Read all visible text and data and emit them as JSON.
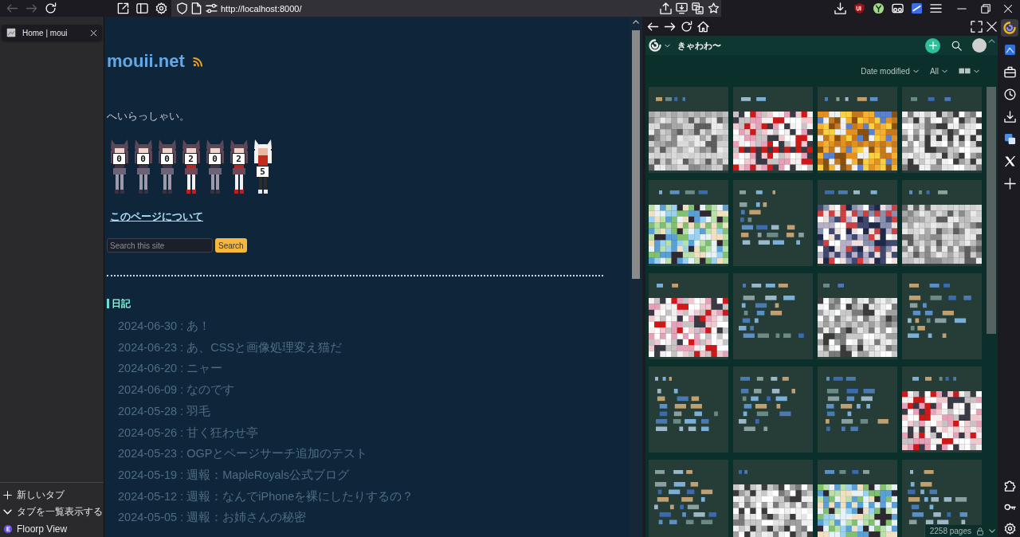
{
  "browser": {
    "back": {
      "disabled": true
    },
    "forward": {
      "disabled": true
    },
    "url": "http://localhost:8000/"
  },
  "tabs": [
    {
      "title": "Home | moui",
      "selected": true
    }
  ],
  "tab_sidebar_actions": [
    {
      "kind": "new",
      "label": "新しいタブ"
    },
    {
      "kind": "list",
      "label": "タブを一覧表示する"
    },
    {
      "kind": "view",
      "label": "Floorp View"
    }
  ],
  "page": {
    "site_title": "mouii.net",
    "greeting": "へいらっしゃい。",
    "counter": [
      {
        "digit": "0",
        "kind": "grey"
      },
      {
        "digit": "0",
        "kind": "grey"
      },
      {
        "digit": "0",
        "kind": "grey"
      },
      {
        "digit": "2",
        "kind": "red"
      },
      {
        "digit": "0",
        "kind": "grey"
      },
      {
        "digit": "2",
        "kind": "red"
      },
      {
        "digit": "5",
        "kind": "white"
      }
    ],
    "about_link": "このページについて",
    "search": {
      "placeholder": "Search this site",
      "button": "Search"
    },
    "diary": {
      "heading": "日記",
      "entries": [
        "2024-06-30 : あ！",
        "2024-06-23 : あ、CSSと画像処理変え猫だ",
        "2024-06-20 : ニャー",
        "2024-06-09 : なのです",
        "2024-05-28 : 羽毛",
        "2024-05-26 : 甘く狂わせ亭",
        "2024-05-23 : OGPとページサーチ追加のテスト",
        "2024-05-19 : 週報：MapleRoyals公式ブログ",
        "2024-05-12 : 週報：なんでiPhoneを裸にしたりするの？",
        "2024-05-05 : 週報：お姉さんの秘密"
      ]
    }
  },
  "web_panel": {
    "title": "きゃわわ〜",
    "sort": "Date modified",
    "filter": "All",
    "cards": [
      {
        "kind": "image"
      },
      {
        "kind": "image"
      },
      {
        "kind": "image"
      },
      {
        "kind": "image"
      },
      {
        "kind": "image"
      },
      {
        "kind": "text"
      },
      {
        "kind": "image"
      },
      {
        "kind": "image"
      },
      {
        "kind": "image"
      },
      {
        "kind": "text"
      },
      {
        "kind": "image"
      },
      {
        "kind": "text"
      },
      {
        "kind": "text"
      },
      {
        "kind": "text"
      },
      {
        "kind": "text"
      },
      {
        "kind": "image"
      },
      {
        "kind": "text"
      },
      {
        "kind": "image"
      },
      {
        "kind": "image"
      },
      {
        "kind": "text"
      }
    ],
    "status": "2258 pages"
  }
}
